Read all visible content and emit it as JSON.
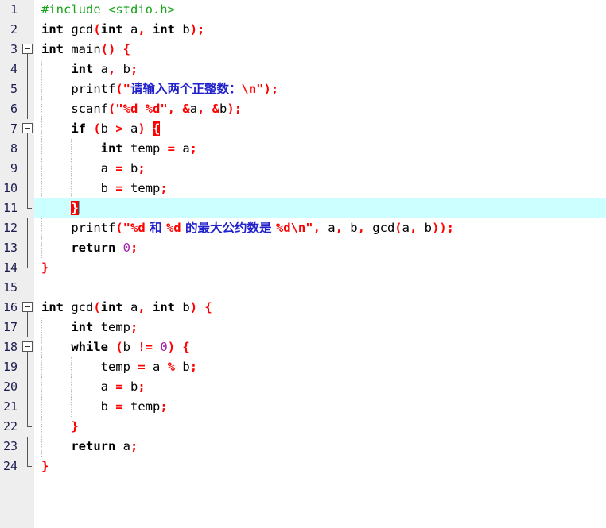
{
  "editor": {
    "language": "C",
    "colors": {
      "gutter_background": "#eeeeee",
      "editor_background": "#ffffff",
      "line_number": "#1b1b4f",
      "keyword": "#000000",
      "identifier": "#000000",
      "punctuation": "#ff0000",
      "operator": "#ff0000",
      "number_literal": "#a020b0",
      "preprocessor": "#19a319",
      "string": "#ff0000",
      "string_cjk": "#2222cc",
      "current_line_highlight": "#ccffff",
      "matching_brace_background": "#ff0000",
      "caret": "#00e5ee"
    },
    "current_line": 11,
    "total_lines": 24,
    "line_numbers": [
      "1",
      "2",
      "3",
      "4",
      "5",
      "6",
      "7",
      "8",
      "9",
      "10",
      "11",
      "12",
      "13",
      "14",
      "15",
      "16",
      "17",
      "18",
      "19",
      "20",
      "21",
      "22",
      "23",
      "24"
    ],
    "fold_markers": [
      {
        "line": 3,
        "type": "open"
      },
      {
        "line": 7,
        "type": "open"
      },
      {
        "line": 11,
        "type": "close"
      },
      {
        "line": 14,
        "type": "end"
      },
      {
        "line": 16,
        "type": "open"
      },
      {
        "line": 18,
        "type": "open"
      },
      {
        "line": 22,
        "type": "close"
      },
      {
        "line": 24,
        "type": "end"
      }
    ],
    "source_lines": [
      "#include <stdio.h>",
      "int gcd(int a, int b);",
      "int main() {",
      "    int a, b;",
      "    printf(\"请输入两个正整数：\\n\");",
      "    scanf(\"%d %d\", &a, &b);",
      "    if (b > a) {",
      "        int temp = a;",
      "        a = b;",
      "        b = temp;",
      "    }",
      "    printf(\"%d 和 %d 的最大公约数是 %d\\n\", a, b, gcd(a, b));",
      "    return 0;",
      "}",
      "",
      "int gcd(int a, int b) {",
      "    int temp;",
      "    while (b != 0) {",
      "        temp = a % b;",
      "        a = b;",
      "        b = temp;",
      "    }",
      "    return a;",
      "}"
    ],
    "tokens": {
      "l1_include": "#include <stdio.h>",
      "l2_kw_int": "int",
      "l2_name": " gcd",
      "l2_p1": "(",
      "l2_kw2": "int",
      "l2_a": " a",
      "l2_c1": ",",
      "l2_kw3": " int",
      "l2_b": " b",
      "l2_p2": ");",
      "l3_kw": "int",
      "l3_name": " main",
      "l3_p": "() ",
      "l3_brace": "{",
      "l4_kw": "int",
      "l4_rest": " a",
      "l4_c": ",",
      "l4_b": " b",
      "l4_semi": ";",
      "l5_name": "printf",
      "l5_p1": "(\"",
      "l5_cjk": "请输入两个正整数：",
      "l5_nl": "\\n\"",
      "l5_p2": ");",
      "l6_name": "scanf",
      "l6_p1": "(",
      "l6_str": "\"%d %d\"",
      "l6_c1": ",",
      "l6_amp1": " &",
      "l6_a": "a",
      "l6_c2": ",",
      "l6_amp2": " &",
      "l6_bb": "b",
      "l6_p2": ");",
      "l7_kw": "if",
      "l7_p1": " (",
      "l7_b": "b",
      "l7_gt": " > ",
      "l7_a": "a",
      "l7_p2": ") ",
      "l7_brace": "{",
      "l8_kw": "int",
      "l8_temp": " temp ",
      "l8_eq": "=",
      "l8_a": " a",
      "l8_semi": ";",
      "l9_a": "a ",
      "l9_eq": "=",
      "l9_b": " b",
      "l9_semi": ";",
      "l10_b": "b ",
      "l10_eq": "=",
      "l10_temp": " temp",
      "l10_semi": ";",
      "l11_brace": "}",
      "l12_name": "printf",
      "l12_p1": "(\"%d",
      "l12_cjk1": " 和 ",
      "l12_pd2": "%d",
      "l12_cjk2": " 的最大公约数是 ",
      "l12_pd3": "%d\\n\"",
      "l12_c1": ",",
      "l12_a": " a",
      "l12_c2": ",",
      "l12_b": " b",
      "l12_c3": ",",
      "l12_gcd": " gcd",
      "l12_p2": "(",
      "l12_ga": "a",
      "l12_c4": ",",
      "l12_gb": " b",
      "l12_p3": "));",
      "l13_kw": "return",
      "l13_zero": " 0",
      "l13_semi": ";",
      "l14_brace": "}",
      "l16_kw": "int",
      "l16_name": " gcd",
      "l16_p1": "(",
      "l16_kw2": "int",
      "l16_a": " a",
      "l16_c1": ",",
      "l16_kw3": " int",
      "l16_b": " b",
      "l16_p2": ") ",
      "l16_brace": "{",
      "l17_kw": "int",
      "l17_temp": " temp",
      "l17_semi": ";",
      "l18_kw": "while",
      "l18_p1": " (",
      "l18_b": "b ",
      "l18_ne": "!=",
      "l18_zero": " 0",
      "l18_p2": ") ",
      "l18_brace": "{",
      "l19_temp": "temp ",
      "l19_eq": "=",
      "l19_a": " a ",
      "l19_mod": "%",
      "l19_b": " b",
      "l19_semi": ";",
      "l20_a": "a ",
      "l20_eq": "=",
      "l20_b": " b",
      "l20_semi": ";",
      "l21_b": "b ",
      "l21_eq": "=",
      "l21_temp": " temp",
      "l21_semi": ";",
      "l22_brace": "}",
      "l23_kw": "return",
      "l23_a": " a",
      "l23_semi": ";",
      "l24_brace": "}"
    }
  }
}
